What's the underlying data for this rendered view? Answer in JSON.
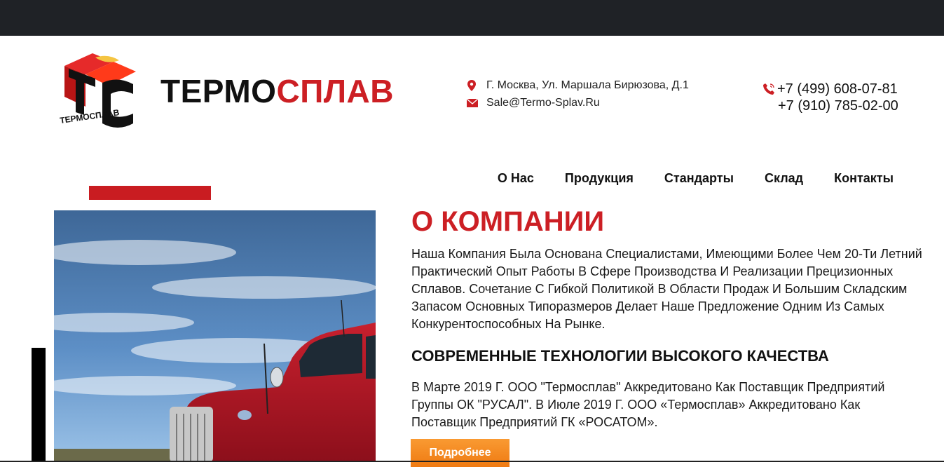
{
  "colors": {
    "topbar": "#1f2226",
    "accent_red": "#cc1f24",
    "button_orange": "#f28a1f",
    "text": "#1a1a1a"
  },
  "logo": {
    "mark_letters": "ТС",
    "mark_caption": "ТЕРМОСПЛАВ"
  },
  "brand": {
    "part1": "ТЕРМО",
    "part2": "СПЛАВ"
  },
  "contacts": {
    "address_icon": "map-pin-icon",
    "address": "Г. Москва, Ул. Маршала Бирюзова, Д.1",
    "email_icon": "envelope-icon",
    "email": "Sale@Termo-Splav.Ru",
    "phone_icon": "phone-icon",
    "phone1": "+7 (499) 608-07-81",
    "phone2": "+7 (910) 785-02-00"
  },
  "nav": {
    "items": [
      {
        "label": "О Нас"
      },
      {
        "label": "Продукция"
      },
      {
        "label": "Стандарты"
      },
      {
        "label": "Склад"
      },
      {
        "label": "Контакты"
      }
    ]
  },
  "about": {
    "title": "О КОМПАНИИ",
    "text": "Наша Компания Была Основана Специалистами, Имеющими Более Чем 20-Ти Летний Практический Опыт Работы В Сфере Производства И Реализации Прецизионных Сплавов. Сочетание С Гибкой Политикой В Области Продаж И Большим Складским Запасом Основных Типоразмеров Делает Наше Предложение Одним Из Самых Конкурентоспособных На Рынке.",
    "subtitle": "СОВРЕМЕННЫЕ ТЕХНОЛОГИИ ВЫСОКОГО КАЧЕСТВА",
    "text2": "В Марте 2019 Г. ООО \"Термосплав\" Аккредитовано Как Поставщик Предприятий Группы ОК \"РУСАЛ\". В Июле 2019 Г. ООО «Термосплав» Аккредитовано Как Поставщик Предприятий ГК «РОСАТОМ».",
    "button_label": "Подробнее"
  }
}
